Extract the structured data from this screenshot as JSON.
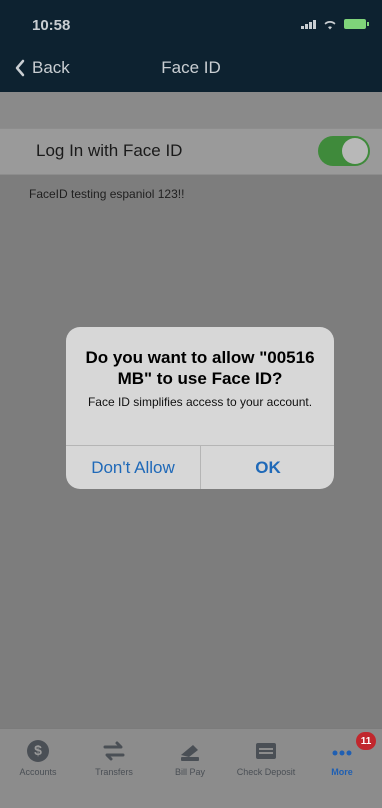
{
  "status": {
    "time": "10:58"
  },
  "nav": {
    "back_label": "Back",
    "title": "Face ID"
  },
  "settings": {
    "face_id_label": "Log In with Face ID",
    "face_id_enabled": true
  },
  "note": {
    "text": "FaceID testing espaniol 123!!"
  },
  "alert": {
    "title": "Do you want to allow \"00516 MB\" to use Face ID?",
    "message": "Face ID simplifies access to your account.",
    "deny_label": "Don't Allow",
    "ok_label": "OK"
  },
  "tabbar": {
    "items": [
      {
        "label": "Accounts",
        "icon": "dollar-icon"
      },
      {
        "label": "Transfers",
        "icon": "transfer-arrows-icon"
      },
      {
        "label": "Bill Pay",
        "icon": "bill-pay-icon"
      },
      {
        "label": "Check Deposit",
        "icon": "check-deposit-icon"
      },
      {
        "label": "More",
        "icon": "more-icon",
        "badge": "11",
        "active": true
      }
    ]
  },
  "colors": {
    "header": "#0d2230",
    "toggle_on": "#3f8a3b",
    "accent": "#1f69b8",
    "badge": "#c1272d"
  }
}
